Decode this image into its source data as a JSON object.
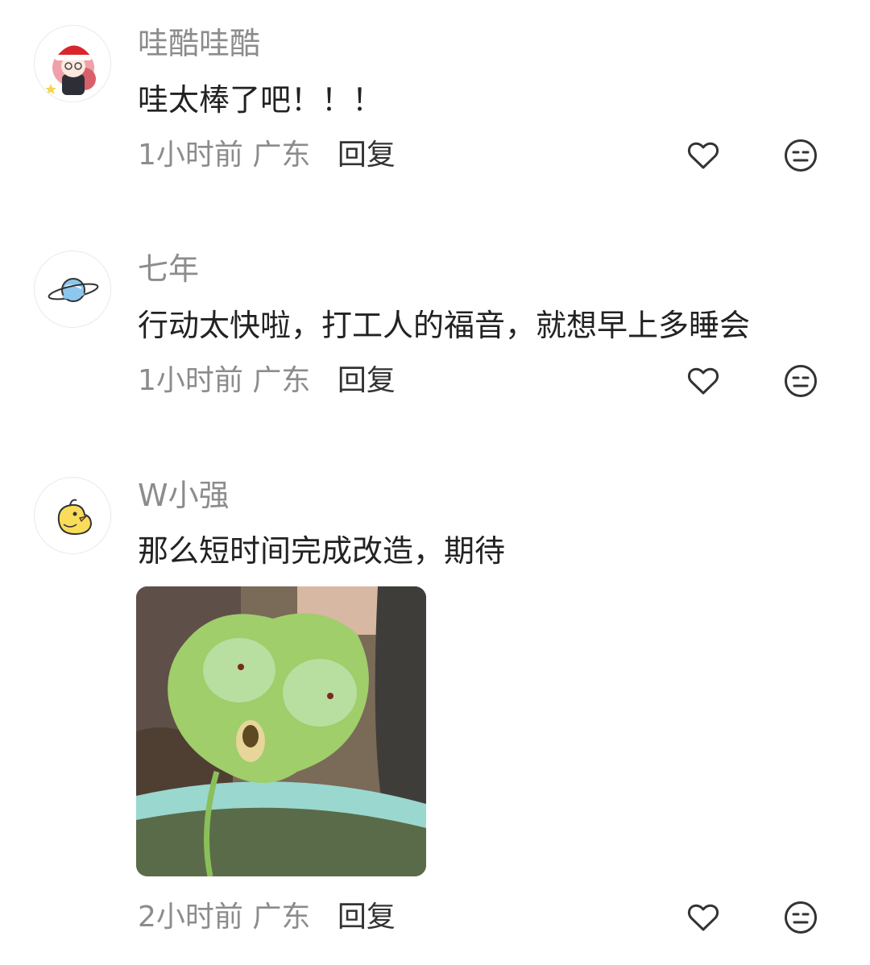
{
  "comments": [
    {
      "username": "哇酷哇酷",
      "text": "哇太棒了吧！！！",
      "time": "1小时前",
      "location": "广东",
      "reply_label": "回复",
      "avatar_icon": "santa-girl-avatar"
    },
    {
      "username": "七年",
      "text": "行动太快啦，打工人的福音，就想早上多睡会",
      "time": "1小时前",
      "location": "广东",
      "reply_label": "回复",
      "avatar_icon": "planet-avatar"
    },
    {
      "username": "W小强",
      "text": "那么短时间完成改造，期待",
      "time": "2小时前",
      "location": "广东",
      "reply_label": "回复",
      "avatar_icon": "chick-avatar",
      "image_icon": "green-leaf-creature-meme"
    }
  ],
  "icons": {
    "like": "heart-outline-icon",
    "dislike": "meh-face-icon"
  },
  "colors": {
    "username": "#8c8c8c",
    "text": "#222222",
    "meta": "#8c8c8c",
    "reply": "#333333",
    "icon": "#333333"
  }
}
